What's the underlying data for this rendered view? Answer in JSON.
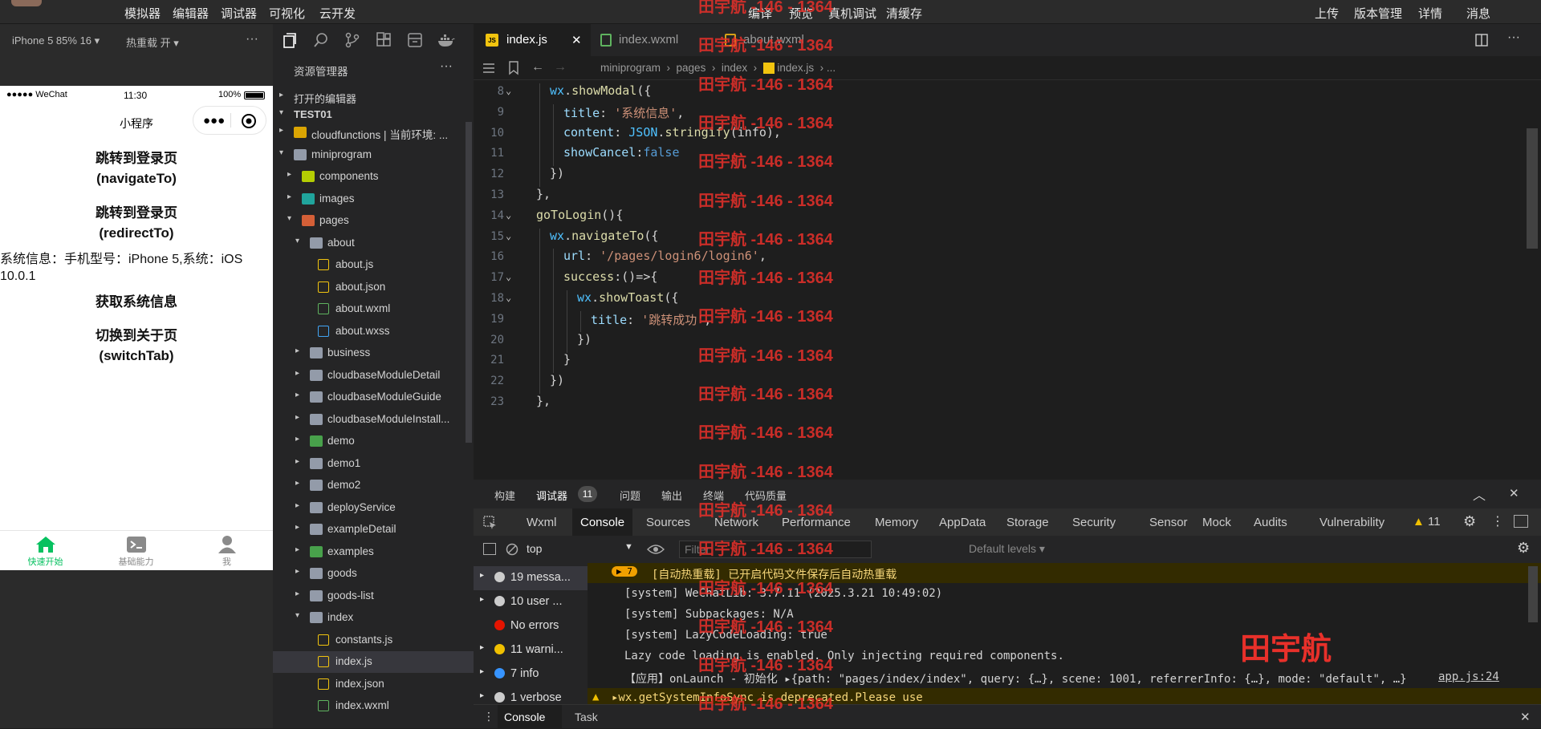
{
  "menu": {
    "left": [
      "模拟器",
      "编辑器",
      "调试器",
      "可视化",
      "云开发"
    ],
    "center": [
      "编译",
      "预览",
      "真机调试",
      "清缓存"
    ],
    "right": [
      "上传",
      "版本管理",
      "详情",
      "消息"
    ]
  },
  "simulator": {
    "device": "iPhone 5 85% 16 ▾",
    "hot_reload": "热重载 开 ▾",
    "more": "···",
    "status": {
      "signal": "●●●●● WeChat",
      "time": "11:30",
      "battery": "100%"
    },
    "nav_title": "小程序",
    "items": [
      {
        "text": "跳转到登录页\n(navigateTo)"
      },
      {
        "text": "跳转到登录页\n(redirectTo)"
      }
    ],
    "info_text": "系统信息：手机型号：iPhone 5,系统：iOS 10.0.1",
    "btn_sysinfo": "获取系统信息",
    "btn_switch": "切换到关于页\n(switchTab)",
    "tabs": [
      {
        "label": "快速开始",
        "color": "#07c160"
      },
      {
        "label": "基础能力",
        "color": "#8a8a8a"
      },
      {
        "label": "我",
        "color": "#8a8a8a"
      }
    ]
  },
  "explorer": {
    "title": "资源管理器",
    "more": "···",
    "open_editors": "打开的编辑器",
    "project": "TEST01",
    "rows": [
      {
        "name": "cloudfunctions | 当前环境: ...",
        "depth": 1,
        "arrow": "▸",
        "icon": "folder-cloud"
      },
      {
        "name": "miniprogram",
        "depth": 1,
        "arrow": "▾",
        "icon": "folder"
      },
      {
        "name": "components",
        "depth": 2,
        "arrow": "▸",
        "icon": "folder-components"
      },
      {
        "name": "images",
        "depth": 2,
        "arrow": "▸",
        "icon": "folder-images"
      },
      {
        "name": "pages",
        "depth": 2,
        "arrow": "▾",
        "icon": "folder-pages"
      },
      {
        "name": "about",
        "depth": 3,
        "arrow": "▾",
        "icon": "folder"
      },
      {
        "name": "about.js",
        "depth": 4,
        "arrow": "",
        "icon": "js"
      },
      {
        "name": "about.json",
        "depth": 4,
        "arrow": "",
        "icon": "json"
      },
      {
        "name": "about.wxml",
        "depth": 4,
        "arrow": "",
        "icon": "wxml"
      },
      {
        "name": "about.wxss",
        "depth": 4,
        "arrow": "",
        "icon": "css"
      },
      {
        "name": "business",
        "depth": 3,
        "arrow": "▸",
        "icon": "folder"
      },
      {
        "name": "cloudbaseModuleDetail",
        "depth": 3,
        "arrow": "▸",
        "icon": "folder"
      },
      {
        "name": "cloudbaseModuleGuide",
        "depth": 3,
        "arrow": "▸",
        "icon": "folder"
      },
      {
        "name": "cloudbaseModuleInstall...",
        "depth": 3,
        "arrow": "▸",
        "icon": "folder"
      },
      {
        "name": "demo",
        "depth": 3,
        "arrow": "▸",
        "icon": "folder-green"
      },
      {
        "name": "demo1",
        "depth": 3,
        "arrow": "▸",
        "icon": "folder"
      },
      {
        "name": "demo2",
        "depth": 3,
        "arrow": "▸",
        "icon": "folder"
      },
      {
        "name": "deployService",
        "depth": 3,
        "arrow": "▸",
        "icon": "folder"
      },
      {
        "name": "exampleDetail",
        "depth": 3,
        "arrow": "▸",
        "icon": "folder"
      },
      {
        "name": "examples",
        "depth": 3,
        "arrow": "▸",
        "icon": "folder-green"
      },
      {
        "name": "goods",
        "depth": 3,
        "arrow": "▸",
        "icon": "folder"
      },
      {
        "name": "goods-list",
        "depth": 3,
        "arrow": "▸",
        "icon": "folder"
      },
      {
        "name": "index",
        "depth": 3,
        "arrow": "▾",
        "icon": "folder"
      },
      {
        "name": "constants.js",
        "depth": 4,
        "arrow": "",
        "icon": "js"
      },
      {
        "name": "index.js",
        "depth": 4,
        "arrow": "",
        "icon": "js",
        "selected": true
      },
      {
        "name": "index.json",
        "depth": 4,
        "arrow": "",
        "icon": "json"
      },
      {
        "name": "index.wxml",
        "depth": 4,
        "arrow": "",
        "icon": "wxml"
      }
    ]
  },
  "editor": {
    "tabs": [
      {
        "label": "index.js",
        "icon": "js",
        "active": true,
        "close": "✕"
      },
      {
        "label": "index.wxml",
        "icon": "wxml"
      },
      {
        "label": "about.wxml",
        "icon": "wxml-yellow"
      }
    ],
    "breadcrumb": [
      "miniprogram",
      "pages",
      "index",
      "index.js",
      "..."
    ],
    "lines": [
      {
        "n": "8",
        "indent": 1,
        "fold": true,
        "html": "<span class='wx'>wx</span>.<span class='fn'>showModal</span>({"
      },
      {
        "n": "9",
        "indent": 2,
        "html": "<span class='kw'>title</span>: <span class='str'>'系统信息'</span>,"
      },
      {
        "n": "10",
        "indent": 2,
        "html": "<span class='kw'>content</span>: <span class='wx'>JSON</span>.<span class='fn'>stringify</span>(info),"
      },
      {
        "n": "11",
        "indent": 2,
        "html": "<span class='kw'>showCancel</span>:<span class='bool'>false</span>"
      },
      {
        "n": "12",
        "indent": 1,
        "html": "})"
      },
      {
        "n": "13",
        "indent": 0,
        "html": "},"
      },
      {
        "n": "14",
        "indent": 0,
        "fold": true,
        "html": "<span class='fn'>goToLogin</span>(){"
      },
      {
        "n": "15",
        "indent": 1,
        "fold": true,
        "html": "<span class='wx'>wx</span>.<span class='fn'>navigateTo</span>({"
      },
      {
        "n": "16",
        "indent": 2,
        "html": "<span class='kw'>url</span>: <span class='str'>'/pages/login6/login6'</span>,"
      },
      {
        "n": "17",
        "indent": 2,
        "fold": true,
        "html": "<span class='fn'>success</span>:()=>{"
      },
      {
        "n": "18",
        "indent": 3,
        "fold": true,
        "html": "<span class='wx'>wx</span>.<span class='fn'>showToast</span>({"
      },
      {
        "n": "19",
        "indent": 4,
        "html": "<span class='kw'>title</span>: <span class='str'>'跳转成功'</span>,"
      },
      {
        "n": "20",
        "indent": 3,
        "html": "})"
      },
      {
        "n": "21",
        "indent": 2,
        "html": "}"
      },
      {
        "n": "22",
        "indent": 1,
        "html": "})"
      },
      {
        "n": "23",
        "indent": 0,
        "html": "},"
      }
    ],
    "watermark": "田宇航 -146 - 1364",
    "watermark_big": "田宇航"
  },
  "panel": {
    "tabs": [
      "构建",
      "调试器",
      "问题",
      "输出",
      "终端",
      "代码质量"
    ],
    "debugger_badge": "11",
    "devtabs": [
      "Wxml",
      "Console",
      "Sources",
      "Network",
      "Performance",
      "Memory",
      "AppData",
      "Storage",
      "Security",
      "Sensor",
      "Mock",
      "Audits",
      "Vulnerability"
    ],
    "warn_count": "11",
    "context": "top",
    "filter_placeholder": "Filter",
    "levels": "Default levels ▾",
    "sidebar": [
      {
        "label": "19 messa...",
        "icon": "list-icon",
        "color": "#cccccc"
      },
      {
        "label": "10 user ...",
        "icon": "user-icon",
        "color": "#cccccc"
      },
      {
        "label": "No errors",
        "icon": "error-icon",
        "color": "#e51400"
      },
      {
        "label": "11 warni...",
        "icon": "warning-icon",
        "color": "#f0c000"
      },
      {
        "label": "7 info",
        "icon": "info-icon",
        "color": "#3794ff"
      },
      {
        "label": "1 verbose",
        "icon": "verbose-icon",
        "color": "#cccccc"
      }
    ],
    "logs": [
      {
        "text": "[自动热重载] 已开启代码文件保存后自动热重载",
        "badge": "▶ 7",
        "type": "warn-head"
      },
      {
        "text": "[system] WeChatLib: 3.7.11 (2025.3.21 10:49:02)"
      },
      {
        "text": "[system] Subpackages: N/A"
      },
      {
        "text": "[system] LazyCodeLoading: true"
      },
      {
        "text": "Lazy code loading is enabled. Only injecting required components."
      },
      {
        "text": "【应用】onLaunch - 初始化 ▸{path: \"pages/index/index\", query: {…}, scene: 1001, referrerInfo: {…}, mode: \"default\", …}",
        "link": "app.js:24"
      },
      {
        "text": "▸wx.getSystemInfoSync is deprecated.Please use",
        "type": "warn"
      }
    ],
    "bottom_tabs": [
      "Console",
      "Task"
    ]
  }
}
